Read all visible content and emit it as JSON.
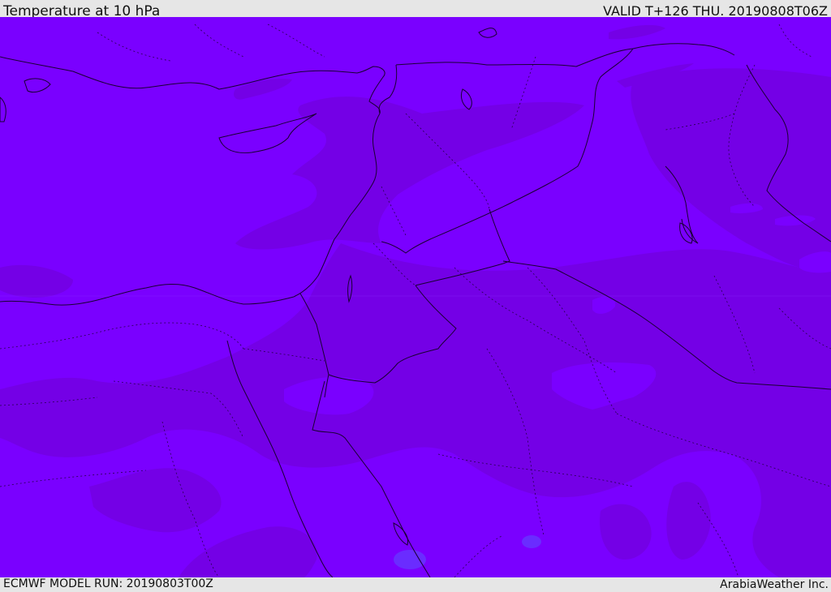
{
  "header": {
    "title": "Temperature at 10 hPa",
    "valid": "VALID T+126 THU. 20190808T06Z"
  },
  "footer": {
    "model_run": "ECMWF MODEL RUN: 20190803T00Z",
    "credit": "ArabiaWeather Inc."
  },
  "colors": {
    "field_base": "#7a00ff",
    "field_warm": "#7400e6",
    "field_cool": "#6a2cff",
    "borders": "#1a0033",
    "bars": "#e6e6e6"
  }
}
